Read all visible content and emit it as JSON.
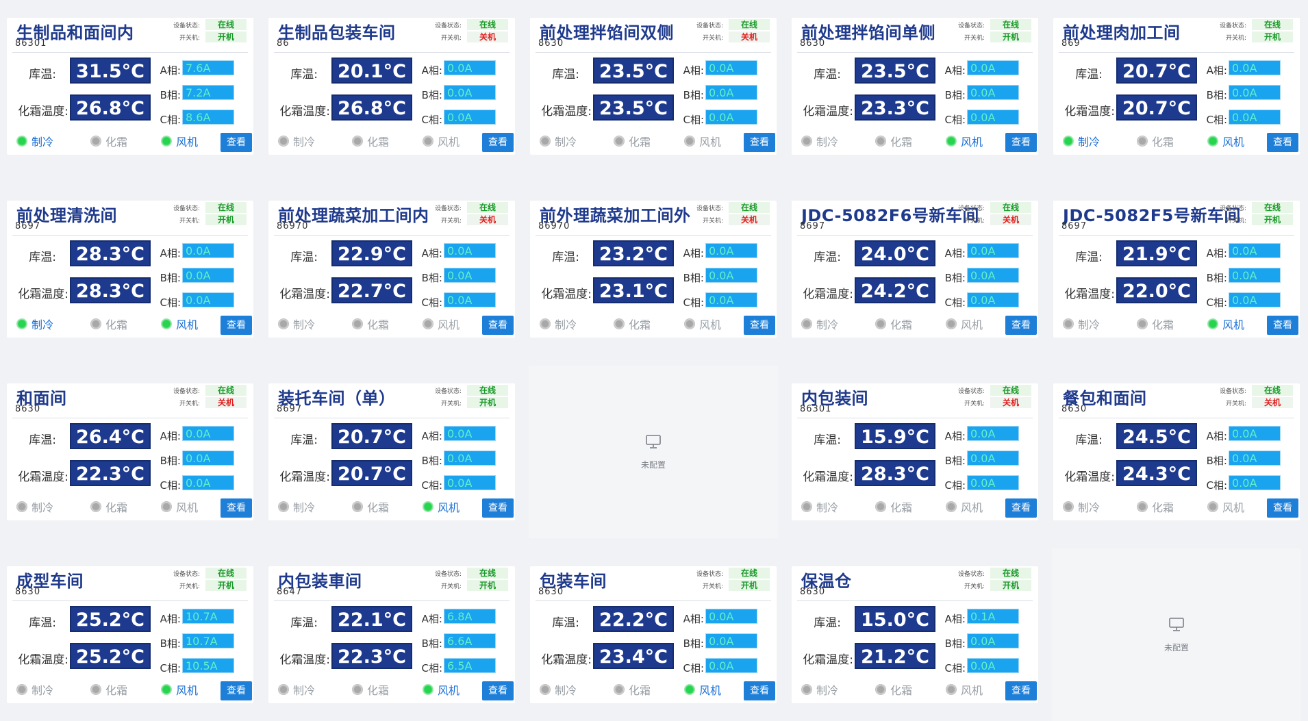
{
  "labels": {
    "device_status": "设备状态:",
    "power": "开关机:",
    "room_temp": "库温:",
    "defrost_temp": "化霜温度:",
    "phase_a": "A相:",
    "phase_b": "B相:",
    "phase_c": "C相:",
    "cooling": "制冷",
    "defrost": "化霜",
    "fan": "风机",
    "view": "查看",
    "unconfigured": "未配置"
  },
  "cards": [
    {
      "title": "生制品和面间内",
      "id": "86301",
      "online": "在线",
      "power": "开机",
      "power_on": true,
      "temp": "31.5°C",
      "defrost_temp": "26.8°C",
      "a": "7.6A",
      "b": "7.2A",
      "c": "8.6A",
      "cooling": true,
      "defrost": false,
      "fan": true
    },
    {
      "title": "生制品包装车间",
      "id": "86",
      "online": "在线",
      "power": "关机",
      "power_on": false,
      "temp": "20.1°C",
      "defrost_temp": "26.8°C",
      "a": "0.0A",
      "b": "0.0A",
      "c": "0.0A",
      "cooling": false,
      "defrost": false,
      "fan": false
    },
    {
      "title": "前处理拌馅间双侧",
      "id": "8630",
      "online": "在线",
      "power": "关机",
      "power_on": false,
      "temp": "23.5°C",
      "defrost_temp": "23.5°C",
      "a": "0.0A",
      "b": "0.0A",
      "c": "0.0A",
      "cooling": false,
      "defrost": false,
      "fan": false
    },
    {
      "title": "前处理拌馅间单侧",
      "id": "8630",
      "online": "在线",
      "power": "开机",
      "power_on": true,
      "temp": "23.5°C",
      "defrost_temp": "23.3°C",
      "a": "0.0A",
      "b": "0.0A",
      "c": "0.0A",
      "cooling": false,
      "defrost": false,
      "fan": true
    },
    {
      "title": "前处理肉加工间",
      "id": "869",
      "online": "在线",
      "power": "开机",
      "power_on": true,
      "temp": "20.7°C",
      "defrost_temp": "20.7°C",
      "a": "0.0A",
      "b": "0.0A",
      "c": "0.0A",
      "cooling": true,
      "defrost": false,
      "fan": true
    },
    {
      "title": "前处理清洗间",
      "id": "8697",
      "online": "在线",
      "power": "开机",
      "power_on": true,
      "temp": "28.3°C",
      "defrost_temp": "28.3°C",
      "a": "0.0A",
      "b": "0.0A",
      "c": "0.0A",
      "cooling": true,
      "defrost": false,
      "fan": true
    },
    {
      "title": "前处理蔬菜加工间内",
      "id": "86970",
      "online": "在线",
      "power": "关机",
      "power_on": false,
      "temp": "22.9°C",
      "defrost_temp": "22.7°C",
      "a": "0.0A",
      "b": "0.0A",
      "c": "0.0A",
      "cooling": false,
      "defrost": false,
      "fan": false
    },
    {
      "title": "前外理蔬菜加工间外",
      "id": "86970",
      "online": "在线",
      "power": "关机",
      "power_on": false,
      "temp": "23.2°C",
      "defrost_temp": "23.1°C",
      "a": "0.0A",
      "b": "0.0A",
      "c": "0.0A",
      "cooling": false,
      "defrost": false,
      "fan": false
    },
    {
      "title": "JDC-5082F6号新车间未",
      "id": "8697",
      "online": "在线",
      "power": "关机",
      "power_on": false,
      "temp": "24.0°C",
      "defrost_temp": "24.2°C",
      "a": "0.0A",
      "b": "0.0A",
      "c": "0.0A",
      "cooling": false,
      "defrost": false,
      "fan": false
    },
    {
      "title": "JDC-5082F5号新车间",
      "id": "8697",
      "online": "在线",
      "power": "开机",
      "power_on": true,
      "temp": "21.9°C",
      "defrost_temp": "22.0°C",
      "a": "0.0A",
      "b": "0.0A",
      "c": "0.0A",
      "cooling": false,
      "defrost": false,
      "fan": true
    },
    {
      "title": "和面间",
      "id": "8630",
      "online": "在线",
      "power": "关机",
      "power_on": false,
      "temp": "26.4°C",
      "defrost_temp": "22.3°C",
      "a": "0.0A",
      "b": "0.0A",
      "c": "0.0A",
      "cooling": false,
      "defrost": false,
      "fan": false
    },
    {
      "title": "装托车间（单）",
      "id": "8697",
      "online": "在线",
      "power": "开机",
      "power_on": true,
      "temp": "20.7°C",
      "defrost_temp": "20.7°C",
      "a": "0.0A",
      "b": "0.0A",
      "c": "0.0A",
      "cooling": false,
      "defrost": false,
      "fan": true
    },
    {
      "empty": true
    },
    {
      "title": "内包装间",
      "id": "86301",
      "online": "在线",
      "power": "关机",
      "power_on": false,
      "temp": "15.9°C",
      "defrost_temp": "28.3°C",
      "a": "0.0A",
      "b": "0.0A",
      "c": "0.0A",
      "cooling": false,
      "defrost": false,
      "fan": false
    },
    {
      "title": "餐包和面间",
      "id": "8630",
      "online": "在线",
      "power": "关机",
      "power_on": false,
      "temp": "24.5°C",
      "defrost_temp": "24.3°C",
      "a": "0.0A",
      "b": "0.0A",
      "c": "0.0A",
      "cooling": false,
      "defrost": false,
      "fan": false
    },
    {
      "title": "成型车间",
      "id": "8630",
      "online": "在线",
      "power": "开机",
      "power_on": true,
      "temp": "25.2°C",
      "defrost_temp": "25.2°C",
      "a": "10.7A",
      "b": "10.7A",
      "c": "10.5A",
      "cooling": false,
      "defrost": false,
      "fan": true
    },
    {
      "title": "内包装車间",
      "id": "8647",
      "online": "在线",
      "power": "开机",
      "power_on": true,
      "temp": "22.1°C",
      "defrost_temp": "22.3°C",
      "a": "6.8A",
      "b": "6.6A",
      "c": "6.5A",
      "cooling": false,
      "defrost": false,
      "fan": true
    },
    {
      "title": "包装车间",
      "id": "8630",
      "online": "在线",
      "power": "开机",
      "power_on": true,
      "temp": "22.2°C",
      "defrost_temp": "23.4°C",
      "a": "0.0A",
      "b": "0.0A",
      "c": "0.0A",
      "cooling": false,
      "defrost": false,
      "fan": true
    },
    {
      "title": "保温仓",
      "id": "8630",
      "online": "在线",
      "power": "开机",
      "power_on": true,
      "temp": "15.0°C",
      "defrost_temp": "21.2°C",
      "a": "0.1A",
      "b": "0.0A",
      "c": "0.0A",
      "cooling": false,
      "defrost": false,
      "fan": false
    },
    {
      "empty": true
    }
  ]
}
